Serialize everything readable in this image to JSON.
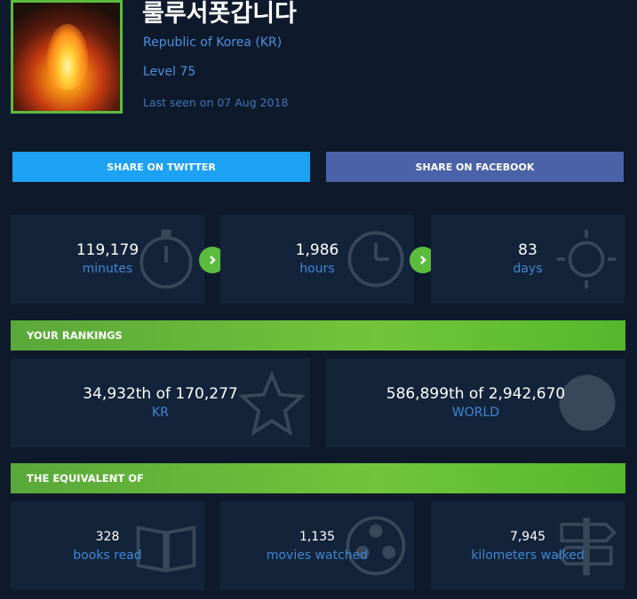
{
  "profile": {
    "name": "룰루서폿갑니다",
    "region": "Republic of Korea (KR)",
    "level": "Level 75",
    "last_seen": "Last seen on 07 Aug 2018"
  },
  "share": {
    "twitter_label": "SHARE ON TWITTER",
    "facebook_label": "SHARE ON FACEBOOK"
  },
  "time_played": [
    {
      "value": "119,179",
      "unit": "minutes"
    },
    {
      "value": "1,986",
      "unit": "hours"
    },
    {
      "value": "83",
      "unit": "days"
    }
  ],
  "rankings": {
    "title": "YOUR RANKINGS",
    "items": [
      {
        "value": "34,932th of 170,277",
        "scope": "KR"
      },
      {
        "value": "586,899th of 2,942,670",
        "scope": "WORLD"
      }
    ]
  },
  "equivalent": {
    "title": "THE EQUIVALENT OF",
    "items": [
      {
        "value": "328",
        "label": "books read"
      },
      {
        "value": "1,135",
        "label": "movies watched"
      },
      {
        "value": "7,945",
        "label": "kilometers walked"
      }
    ]
  },
  "colors": {
    "background": "#0e1a2c",
    "panel": "#13243a",
    "accent_green": "#5cbb3c",
    "link_blue": "#4c8fdc",
    "twitter": "#1da1f2",
    "facebook": "#4b62a8"
  },
  "icons": {
    "arrow": "chevron-right-icon",
    "watermarks": [
      "stopwatch-icon",
      "clock-icon",
      "sun-icon",
      "star-icon",
      "globe-icon",
      "book-icon",
      "film-reel-icon",
      "signpost-icon"
    ]
  }
}
